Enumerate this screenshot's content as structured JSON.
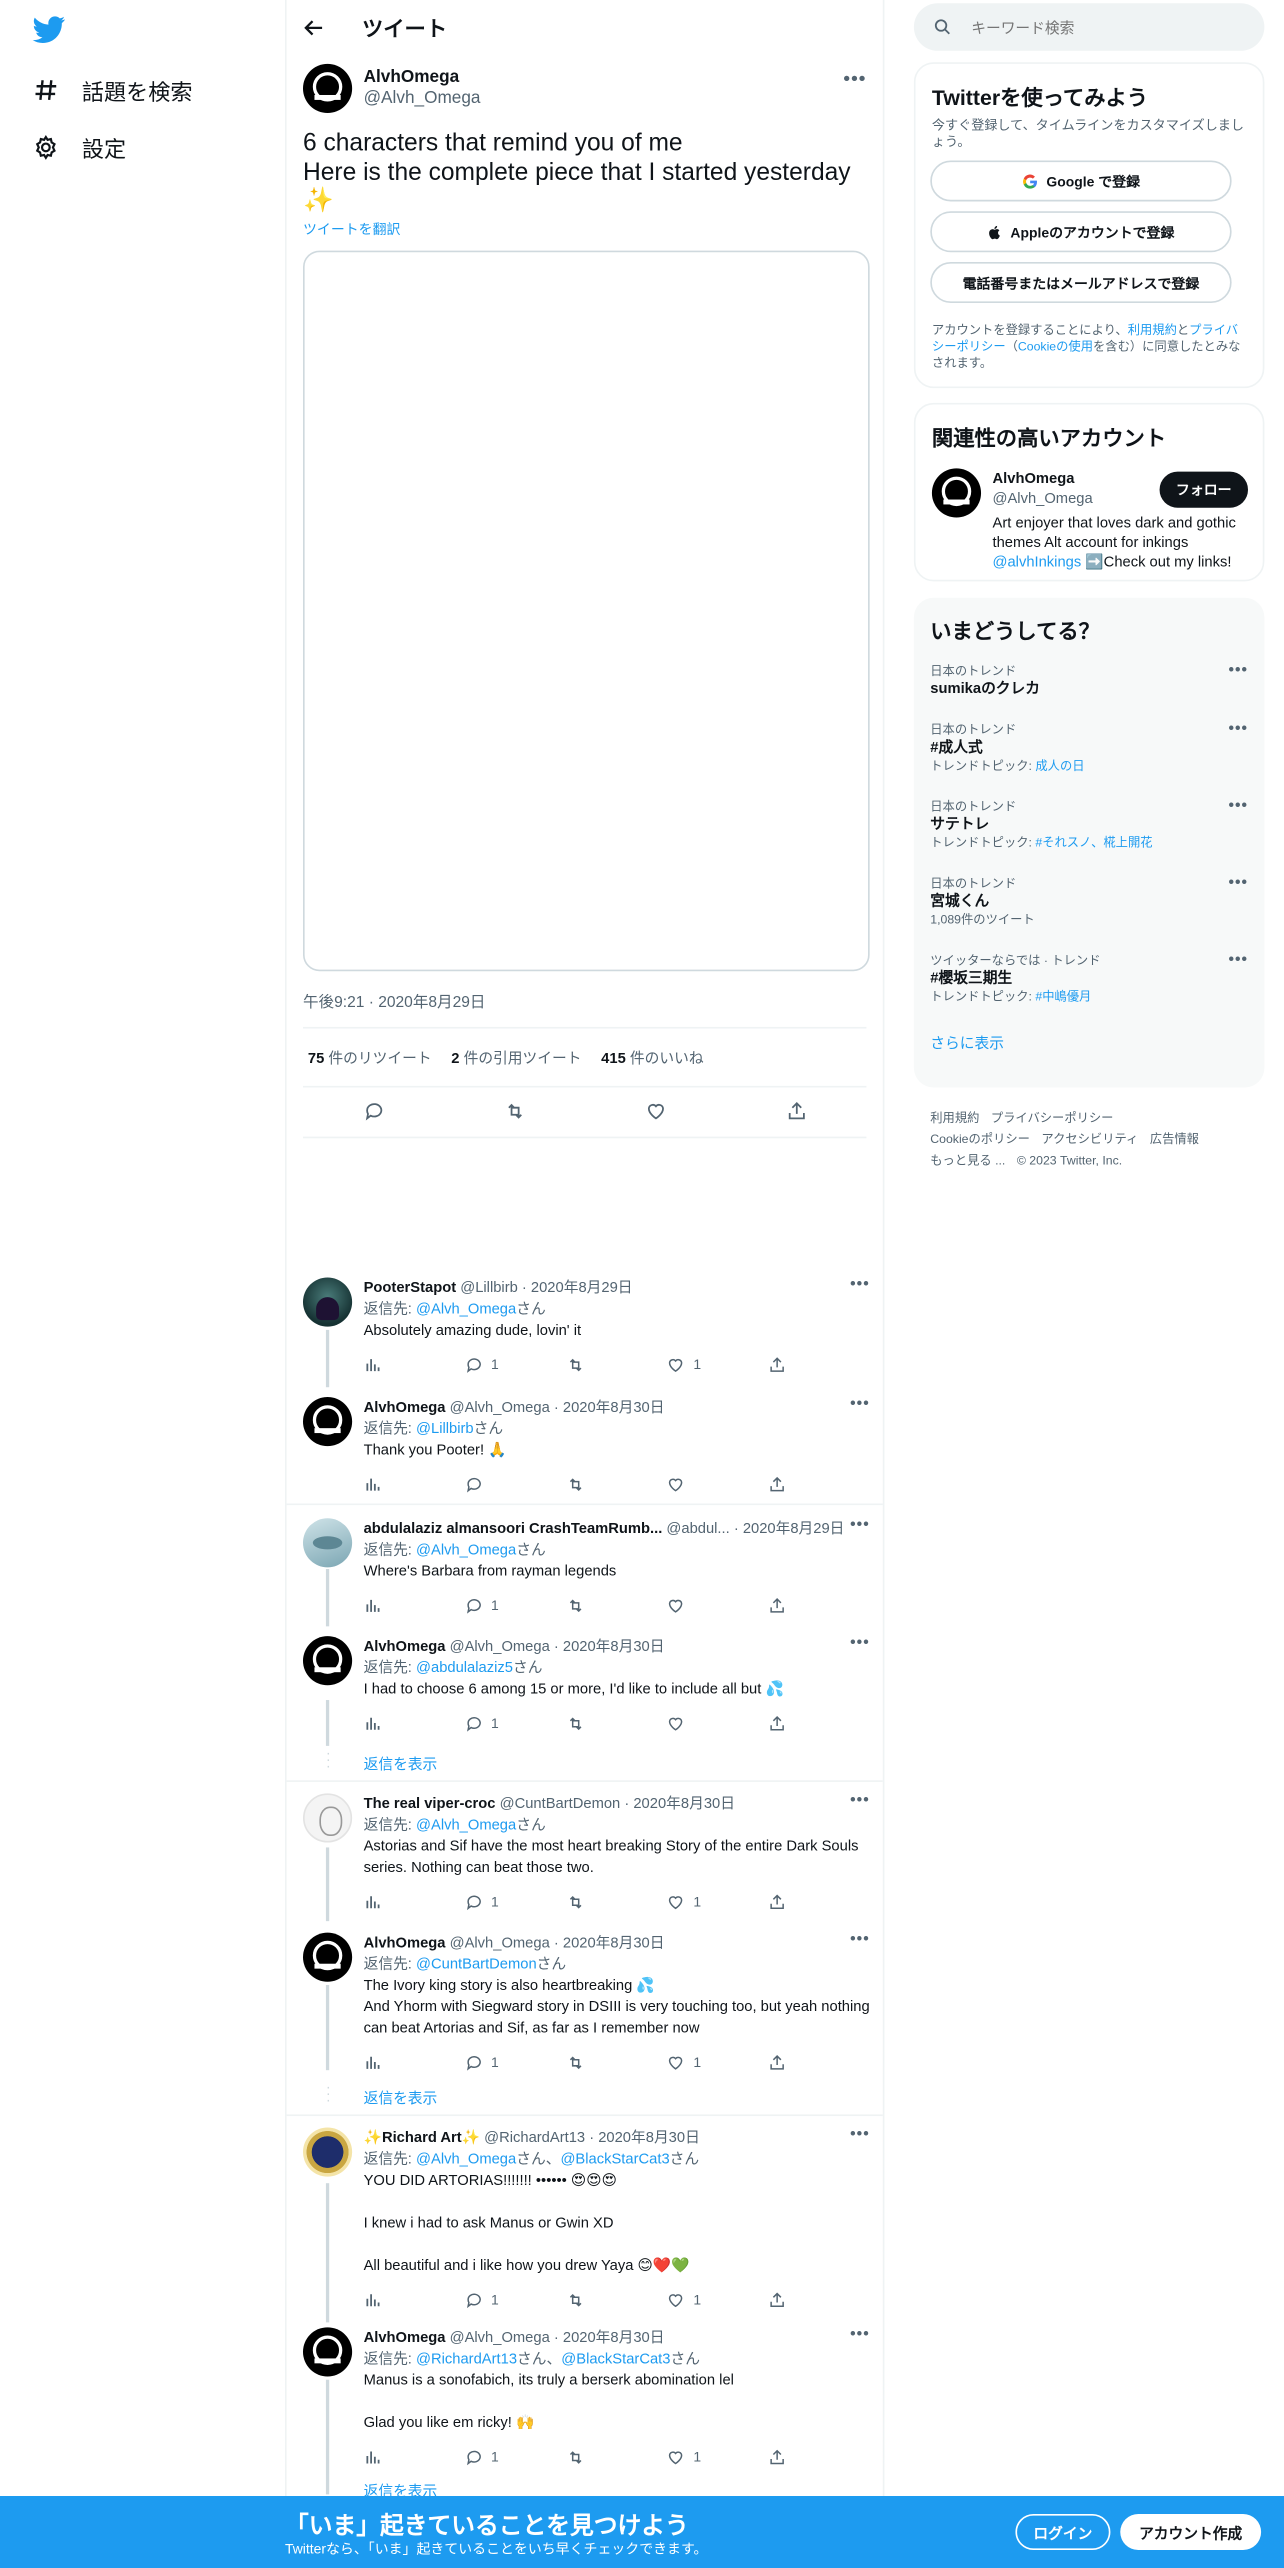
{
  "nav": {
    "explore_label": "話題を検索",
    "settings_label": "設定"
  },
  "header": {
    "title": "ツイート"
  },
  "tweet": {
    "display_name": "AlvhOmega",
    "handle": "@Alvh_Omega",
    "text": "6 characters that remind you of me\nHere is the complete piece that I started yesterday ✨",
    "translate": "ツイートを翻訳",
    "timestamp": "午後9:21 · 2020年8月29日",
    "retweets_num": "75",
    "retweets_label": " 件のリツイート",
    "quotes_num": "2",
    "quotes_label": " 件の引用ツイート",
    "likes_num": "415",
    "likes_label": " 件のいいね"
  },
  "replies": [
    {
      "name": "PooterStapot",
      "meta": " @Lillbirb · 2020年8月29日",
      "replyto_prefix": "返信先: ",
      "replyto_links": "@Alvh_Omega",
      "replyto_suffix": "さん",
      "text": "Absolutely amazing dude, lovin' it",
      "replies": "1",
      "retweets": "",
      "likes": "1"
    },
    {
      "name": "AlvhOmega",
      "meta": " @Alvh_Omega · 2020年8月30日",
      "replyto_prefix": "返信先: ",
      "replyto_links": "@Lillbirb",
      "replyto_suffix": "さん",
      "text": "Thank you Pooter! 🙏",
      "replies": "",
      "retweets": "",
      "likes": ""
    },
    {
      "name": "abdulalaziz almansoori CrashTeamRumb...",
      "meta": " @abdul... · 2020年8月29日",
      "replyto_prefix": "返信先: ",
      "replyto_links": "@Alvh_Omega",
      "replyto_suffix": "さん",
      "text": "Where's Barbara from rayman legends",
      "replies": "1",
      "retweets": "",
      "likes": ""
    },
    {
      "name": "AlvhOmega",
      "meta": " @Alvh_Omega · 2020年8月30日",
      "replyto_prefix": "返信先: ",
      "replyto_links": "@abdulalaziz5",
      "replyto_suffix": "さん",
      "text": "I had to choose 6 among 15 or more, I'd like to include all but 💦",
      "replies": "1",
      "retweets": "",
      "likes": ""
    },
    {
      "name": "The real viper-croc",
      "meta": " @CuntBartDemon · 2020年8月30日",
      "replyto_prefix": "返信先: ",
      "replyto_links": "@Alvh_Omega",
      "replyto_suffix": "さん",
      "text": "Astorias and Sif have the most heart breaking Story of the entire Dark Souls series. Nothing can beat those two.",
      "replies": "1",
      "retweets": "",
      "likes": "1"
    },
    {
      "name": "AlvhOmega",
      "meta": " @Alvh_Omega · 2020年8月30日",
      "replyto_prefix": "返信先: ",
      "replyto_links": "@CuntBartDemon",
      "replyto_suffix": "さん",
      "text": "The Ivory king story is also heartbreaking 💦\nAnd Yhorm with Siegward story in DSIII is very touching too, but yeah nothing can beat Artorias and Sif, as far as I remember now",
      "replies": "1",
      "retweets": "",
      "likes": "1"
    },
    {
      "name": "✨Richard Art✨",
      "meta": " @RichardArt13 · 2020年8月30日",
      "replyto_prefix": "返信先: ",
      "replyto_links": "@Alvh_Omega",
      "replyto_mid": "さん、",
      "replyto_links2": "@BlackStarCat3",
      "replyto_suffix": "さん",
      "text": "YOU DID ARTORIAS!!!!!!! •••••• 😍😍😍\n\nI knew i had to ask Manus or Gwin XD\n\nAll beautiful and i like how you drew Yaya 😊❤️💚",
      "replies": "1",
      "retweets": "",
      "likes": "1"
    },
    {
      "name": "AlvhOmega",
      "meta": " @Alvh_Omega · 2020年8月30日",
      "replyto_prefix": "返信先: ",
      "replyto_links": "@RichardArt13",
      "replyto_mid": "さん、",
      "replyto_links2": "@BlackStarCat3",
      "replyto_suffix": "さん",
      "text": "Manus is a sonofabich, its truly a berserk abomination lel\n\nGlad you like em ricky! 🙌",
      "replies": "1",
      "retweets": "",
      "likes": "1"
    }
  ],
  "show_replies": "返信を表示",
  "search": {
    "placeholder": "キーワード検索"
  },
  "signup": {
    "title": "Twitterを使ってみよう",
    "subtitle": "今すぐ登録して、タイムラインをカスタマイズしましょう。",
    "google": "Google で登録",
    "apple": "Appleのアカウントで登録",
    "phone": "電話番号またはメールアドレスで登録",
    "legal_1": "アカウントを登録することにより、",
    "legal_link1": "利用規約",
    "legal_2": "と",
    "legal_link2": "プライバシーポリシー",
    "legal_3": "（",
    "legal_link3": "Cookieの使用",
    "legal_4": "を含む）に同意したとみなされます。"
  },
  "related": {
    "title": "関連性の高いアカウント",
    "name": "AlvhOmega",
    "handle": "@Alvh_Omega",
    "follow": "フォロー",
    "bio_1": "Art enjoyer that loves dark and gothic themes Alt account for inkings ",
    "bio_link": "@alvhInkings",
    "bio_2": " ➡️Check out my links!"
  },
  "trends": {
    "title": "いまどうしてる？",
    "items": [
      {
        "category": "日本のトレンド",
        "name": "sumikaのクレカ",
        "topic_prefix": "",
        "topic": ""
      },
      {
        "category": "日本のトレンド",
        "name": "#成人式",
        "topic_prefix": "トレンドトピック: ",
        "topic": "成人の日"
      },
      {
        "category": "日本のトレンド",
        "name": "サテトレ",
        "topic_prefix": "トレンドトピック: ",
        "topic": "#それスノ、椛上開花"
      },
      {
        "category": "日本のトレンド",
        "name": "宮城くん",
        "topic_prefix": "1,089件のツイート",
        "topic": ""
      },
      {
        "category": "ツイッターならでは · トレンド",
        "name": "#櫻坂三期生",
        "topic_prefix": "トレンドトピック: ",
        "topic": "#中嶋優月"
      }
    ],
    "show_more": "さらに表示"
  },
  "footer": {
    "terms": "利用規約",
    "privacy": "プライバシーポリシー",
    "cookie": "Cookieのポリシー",
    "accessibility": "アクセシビリティ",
    "ads": "広告情報",
    "more": "もっと見る ...",
    "copyright": "© 2023 Twitter, Inc."
  },
  "bottombar": {
    "headline": "「いま」起きていることを見つけよう",
    "sub": "Twitterなら、「いま」起きていることをいち早くチェックできます。",
    "login": "ログイン",
    "signup": "アカウント作成"
  },
  "colors": {
    "accent": "#1d9bf0",
    "text": "#0f1419",
    "muted": "#536471"
  }
}
